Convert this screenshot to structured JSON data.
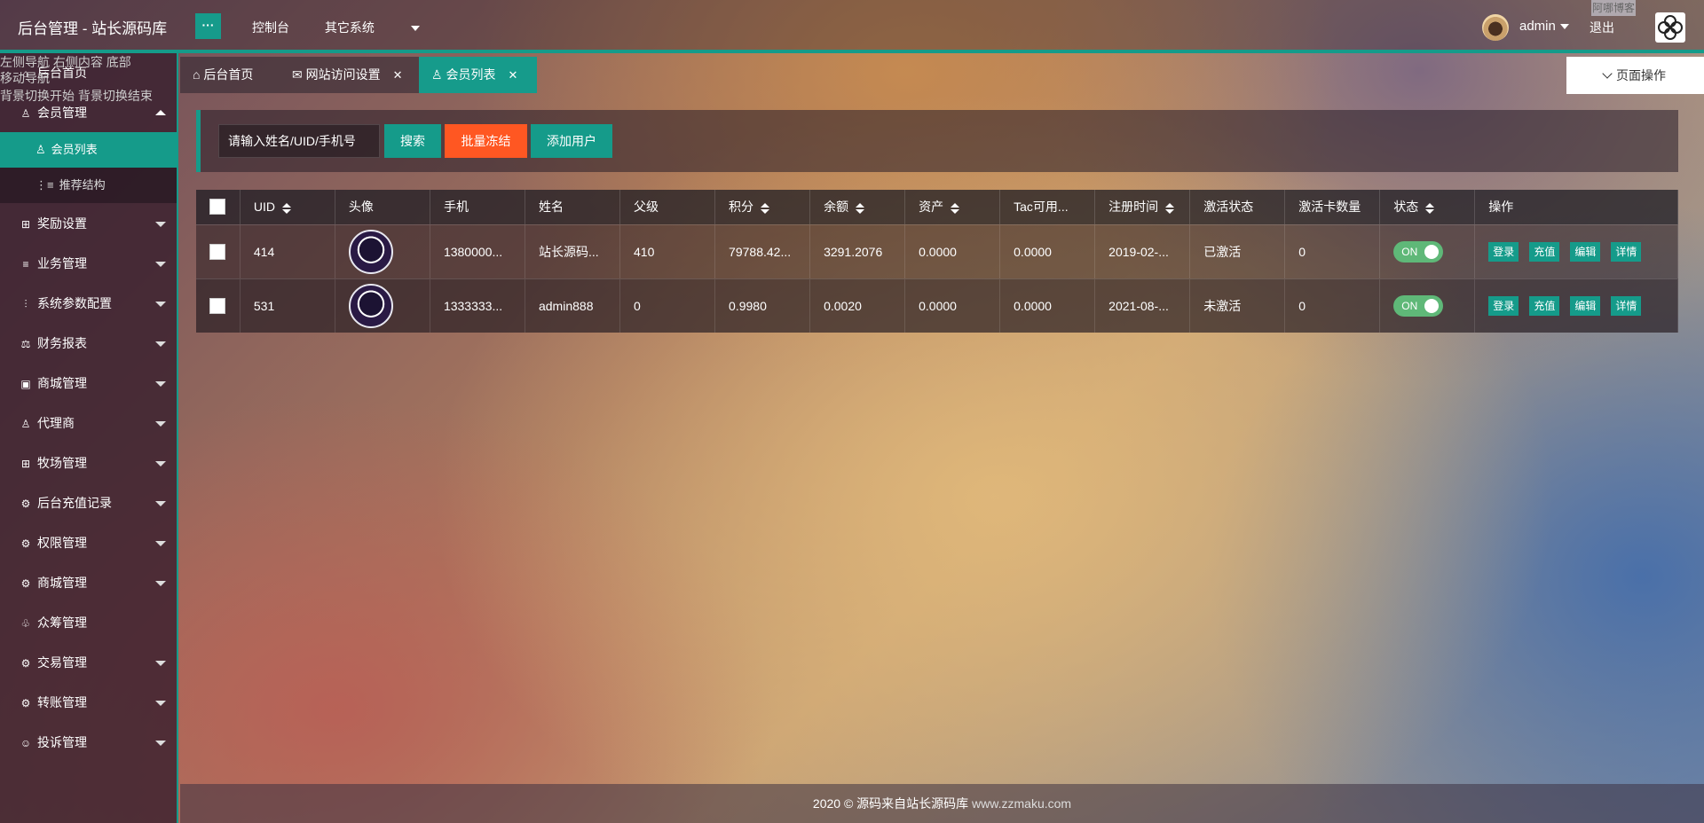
{
  "header": {
    "logo": "后台管理 - 站长源码库",
    "menu_toggle": "···",
    "nav": [
      "控制台",
      "其它系统"
    ],
    "user": "admin",
    "logout": "退出",
    "skin_tag": "阿哪博客"
  },
  "sidebar": {
    "overlay": [
      "左侧导航 右侧内容 底部",
      "移动导航",
      "背景切换开始 背景切换结束"
    ],
    "home": "后台首页",
    "member": "会员管理",
    "member_list": "会员列表",
    "referral": "推荐结构",
    "items": [
      {
        "label": "奖励设置",
        "icon": "gift-icon",
        "glyph": "⊞"
      },
      {
        "label": "业务管理",
        "icon": "list-icon",
        "glyph": "≡"
      },
      {
        "label": "系统参数配置",
        "icon": "sliders-icon",
        "glyph": "⫶"
      },
      {
        "label": "财务报表",
        "icon": "report-icon",
        "glyph": "⚖"
      },
      {
        "label": "商城管理",
        "icon": "shop-icon",
        "glyph": "▣"
      },
      {
        "label": "代理商",
        "icon": "user-icon",
        "glyph": "♙"
      },
      {
        "label": "牧场管理",
        "icon": "ranch-icon",
        "glyph": "⊞"
      },
      {
        "label": "后台充值记录",
        "icon": "gear-icon",
        "glyph": "⚙"
      },
      {
        "label": "权限管理",
        "icon": "gear-icon",
        "glyph": "⚙"
      },
      {
        "label": "商城管理",
        "icon": "gear-icon",
        "glyph": "⚙"
      },
      {
        "label": "众筹管理",
        "icon": "crowdfund-icon",
        "glyph": "♧"
      },
      {
        "label": "交易管理",
        "icon": "gear-icon",
        "glyph": "⚙"
      },
      {
        "label": "转账管理",
        "icon": "gear-icon",
        "glyph": "⚙"
      },
      {
        "label": "投诉管理",
        "icon": "complaint-icon",
        "glyph": "☺"
      }
    ]
  },
  "tabs": {
    "home": "后台首页",
    "site_access": "网站访问设置",
    "member_list": "会员列表",
    "close": "✕",
    "page_ops": "页面操作"
  },
  "toolbar": {
    "search_placeholder": "请输入姓名/UID/手机号",
    "search": "搜索",
    "freeze": "批量冻结",
    "add_user": "添加用户"
  },
  "table": {
    "headers": [
      "UID",
      "头像",
      "手机",
      "姓名",
      "父级",
      "积分",
      "余额",
      "资产",
      "Tac可用...",
      "注册时间",
      "激活状态",
      "激活卡数量",
      "状态",
      "操作"
    ],
    "rows": [
      {
        "uid": "414",
        "phone": "1380000...",
        "name": "站长源码...",
        "parent": "410",
        "points": "79788.42...",
        "balance": "3291.2076",
        "assets": "0.0000",
        "tac": "0.0000",
        "reg_time": "2019-02-...",
        "activation": "已激活",
        "cards": "0",
        "status": "ON"
      },
      {
        "uid": "531",
        "phone": "1333333...",
        "name": "admin888",
        "parent": "0",
        "points": "0.9980",
        "balance": "0.0020",
        "assets": "0.0000",
        "tac": "0.0000",
        "reg_time": "2021-08-...",
        "activation": "未激活",
        "cards": "0",
        "status": "ON"
      }
    ],
    "actions": [
      "登录",
      "充值",
      "编辑",
      "详情"
    ]
  },
  "footer": {
    "text": "2020 © 源码来自站长源码库",
    "site": " www.zzmaku.com"
  },
  "colors": {
    "accent": "#159b8a",
    "orange": "#ff5722",
    "switch_on": "#5fb878"
  }
}
